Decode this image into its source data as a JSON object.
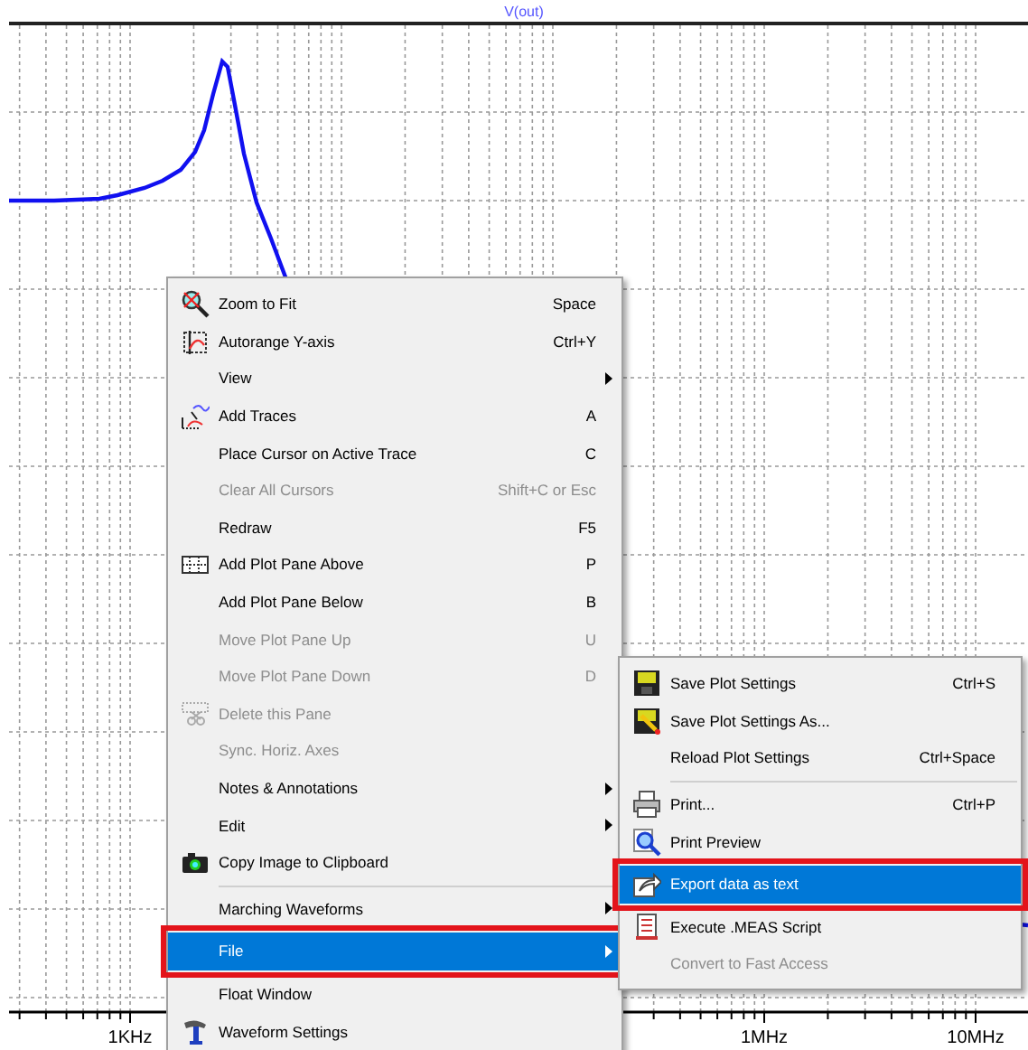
{
  "plot": {
    "trace_label": "V(out)",
    "x_tick_labels": [
      "1KHz",
      "1MHz",
      "10MHz"
    ]
  },
  "context_menu": {
    "items": [
      {
        "kind": "item",
        "label": "Zoom to Fit",
        "shortcut": "Space",
        "disabled": false,
        "has_submenu": false,
        "selected": false,
        "outlined": false
      },
      {
        "kind": "item",
        "label": "Autorange Y-axis",
        "shortcut": "Ctrl+Y",
        "disabled": false,
        "has_submenu": false,
        "selected": false,
        "outlined": false
      },
      {
        "kind": "item",
        "label": "View",
        "disabled": false,
        "has_submenu": true,
        "selected": false,
        "outlined": false
      },
      {
        "kind": "item",
        "label": "Add Traces",
        "shortcut": "A",
        "disabled": false,
        "has_submenu": false,
        "selected": false,
        "outlined": false
      },
      {
        "kind": "item",
        "label": "Place Cursor on Active Trace",
        "shortcut": "C",
        "disabled": false,
        "has_submenu": false,
        "selected": false,
        "outlined": false
      },
      {
        "kind": "item",
        "label": "Clear All Cursors",
        "shortcut": "Shift+C or Esc",
        "disabled": true,
        "has_submenu": false,
        "selected": false,
        "outlined": false
      },
      {
        "kind": "item",
        "label": "Redraw",
        "shortcut": "F5",
        "disabled": false,
        "has_submenu": false,
        "selected": false,
        "outlined": false
      },
      {
        "kind": "item",
        "label": "Add Plot Pane Above",
        "shortcut": "P",
        "disabled": false,
        "has_submenu": false,
        "selected": false,
        "outlined": false
      },
      {
        "kind": "item",
        "label": "Add Plot Pane Below",
        "shortcut": "B",
        "disabled": false,
        "has_submenu": false,
        "selected": false,
        "outlined": false
      },
      {
        "kind": "item",
        "label": "Move Plot Pane Up",
        "shortcut": "U",
        "disabled": true,
        "has_submenu": false,
        "selected": false,
        "outlined": false
      },
      {
        "kind": "item",
        "label": "Move Plot Pane Down",
        "shortcut": "D",
        "disabled": true,
        "has_submenu": false,
        "selected": false,
        "outlined": false
      },
      {
        "kind": "item",
        "label": "Delete this Pane",
        "disabled": true,
        "has_submenu": false,
        "selected": false,
        "outlined": false
      },
      {
        "kind": "item",
        "label": "Sync. Horiz. Axes",
        "disabled": true,
        "has_submenu": false,
        "selected": false,
        "outlined": false
      },
      {
        "kind": "item",
        "label": "Notes & Annotations",
        "disabled": false,
        "has_submenu": true,
        "selected": false,
        "outlined": false
      },
      {
        "kind": "item",
        "label": "Edit",
        "disabled": false,
        "has_submenu": true,
        "selected": false,
        "outlined": false
      },
      {
        "kind": "item",
        "label": "Copy Image to Clipboard",
        "disabled": false,
        "has_submenu": false,
        "selected": false,
        "outlined": false
      },
      {
        "kind": "separator"
      },
      {
        "kind": "item",
        "label": "Marching Waveforms",
        "disabled": false,
        "has_submenu": true,
        "selected": false,
        "outlined": false
      },
      {
        "kind": "item",
        "label": "File",
        "disabled": false,
        "has_submenu": true,
        "selected": true,
        "outlined": true
      },
      {
        "kind": "item",
        "label": "Float Window",
        "disabled": false,
        "has_submenu": false,
        "selected": false,
        "outlined": false
      },
      {
        "kind": "item",
        "label": "Waveform Settings",
        "disabled": false,
        "has_submenu": false,
        "selected": false,
        "outlined": false
      }
    ]
  },
  "file_submenu": {
    "items": [
      {
        "kind": "item",
        "label": "Save Plot Settings",
        "shortcut": "Ctrl+S",
        "disabled": false,
        "has_submenu": false,
        "selected": false,
        "outlined": false
      },
      {
        "kind": "item",
        "label": "Save Plot Settings As...",
        "disabled": false,
        "has_submenu": false,
        "selected": false,
        "outlined": false
      },
      {
        "kind": "item",
        "label": "Reload Plot Settings",
        "shortcut": "Ctrl+Space",
        "disabled": false,
        "has_submenu": false,
        "selected": false,
        "outlined": false
      },
      {
        "kind": "separator"
      },
      {
        "kind": "item",
        "label": "Print...",
        "shortcut": "Ctrl+P",
        "disabled": false,
        "has_submenu": false,
        "selected": false,
        "outlined": false
      },
      {
        "kind": "item",
        "label": "Print Preview",
        "disabled": false,
        "has_submenu": false,
        "selected": false,
        "outlined": false
      },
      {
        "kind": "item",
        "label": "Export data as text",
        "disabled": false,
        "has_submenu": false,
        "selected": true,
        "outlined": true
      },
      {
        "kind": "item",
        "label": "Execute .MEAS Script",
        "disabled": false,
        "has_submenu": false,
        "selected": false,
        "outlined": false
      },
      {
        "kind": "item",
        "label": "Convert to Fast Access",
        "disabled": true,
        "has_submenu": false,
        "selected": false,
        "outlined": false
      }
    ]
  }
}
